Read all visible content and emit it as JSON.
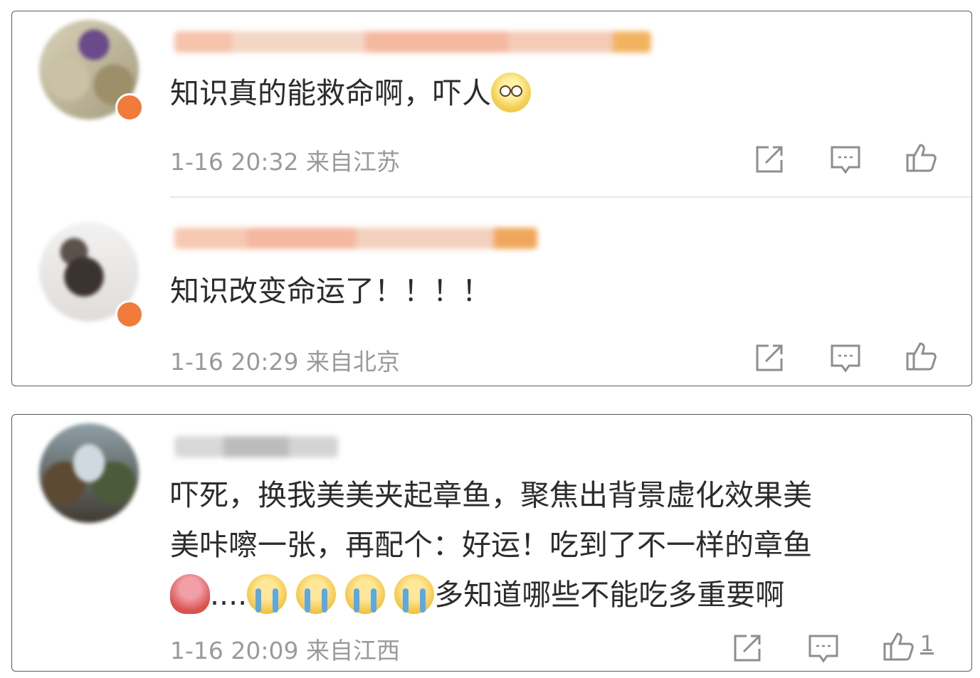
{
  "comments": [
    {
      "text": "知识真的能救命啊，吓人",
      "emoji": "smiling-face-with-tear",
      "time": "1-16 20:32",
      "location": "来自江苏"
    },
    {
      "text": "知识改变命运了！！！！",
      "time": "1-16 20:29",
      "location": "来自北京"
    },
    {
      "line1": "吓死，换我美美夹起章鱼，聚焦出背景虚化效果美",
      "line2": "美咔嚓一张，再配个：好运！吃到了不一样的章鱼",
      "line3_dots": "....",
      "line3_tail": "多知道哪些不能吃多重要啊",
      "emojis": [
        "octopus",
        "loudly-crying-face",
        "loudly-crying-face",
        "loudly-crying-face",
        "loudly-crying-face"
      ],
      "time": "1-16 20:09",
      "location": "来自江西",
      "likes": "1"
    }
  ],
  "colors": {
    "text": "#2c2c2c",
    "meta": "#9a9a9a",
    "icon": "#8e8e8e",
    "badge": "#f07b3a"
  }
}
